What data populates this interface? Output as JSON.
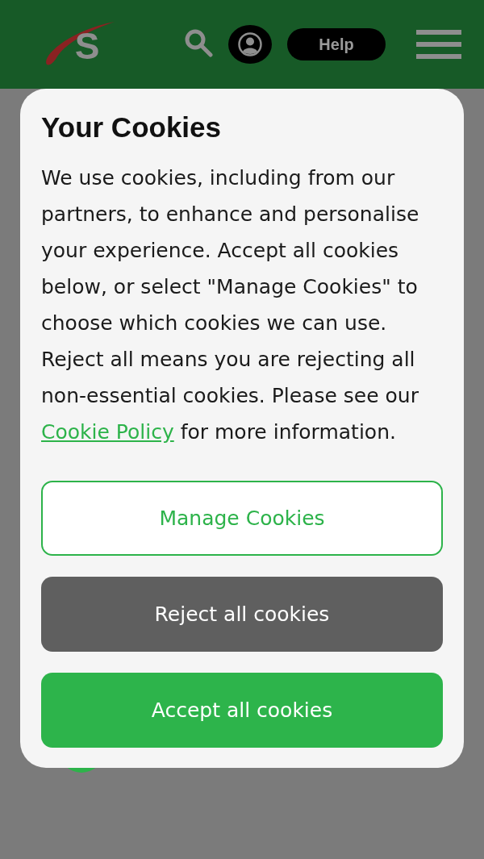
{
  "header": {
    "logo_letter": "S",
    "help_button": "Help"
  },
  "cookie_dialog": {
    "title": "Your Cookies",
    "body": "We use cookies, including from our partners, to enhance and personalise your experience. Accept all cookies below, or select \"Manage Cookies\" to choose which cookies we can use. Reject all means you are rejecting all non-essential cookies. Please see our",
    "link": "Cookie Policy",
    "body_end": "for more information.",
    "buttons": [
      {
        "label": "Manage Cookies",
        "kind": "outline"
      },
      {
        "label": "Reject all cookies",
        "kind": "neutral"
      },
      {
        "label": "Accept all cookies",
        "kind": "primary"
      }
    ]
  }
}
